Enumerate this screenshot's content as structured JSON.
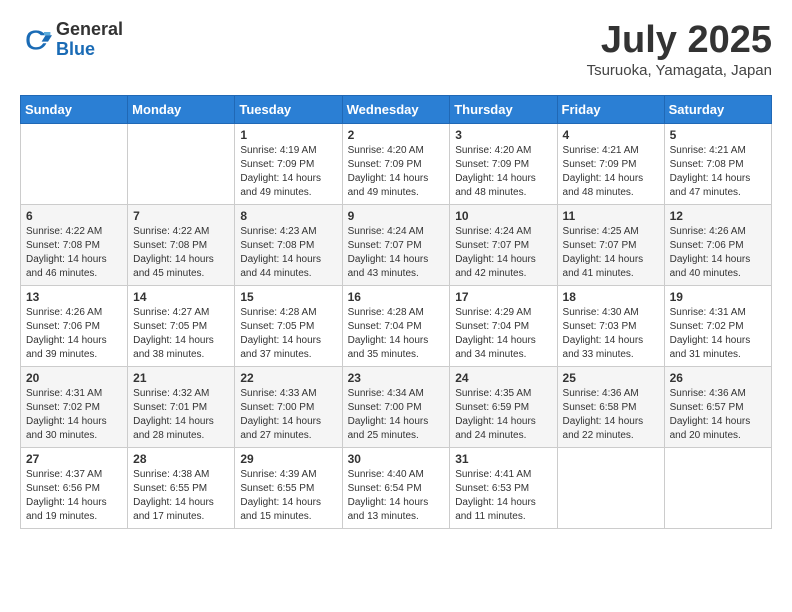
{
  "header": {
    "logo_general": "General",
    "logo_blue": "Blue",
    "month_title": "July 2025",
    "location": "Tsuruoka, Yamagata, Japan"
  },
  "weekdays": [
    "Sunday",
    "Monday",
    "Tuesday",
    "Wednesday",
    "Thursday",
    "Friday",
    "Saturday"
  ],
  "weeks": [
    [
      {
        "day": "",
        "sunrise": "",
        "sunset": "",
        "daylight": ""
      },
      {
        "day": "",
        "sunrise": "",
        "sunset": "",
        "daylight": ""
      },
      {
        "day": "1",
        "sunrise": "Sunrise: 4:19 AM",
        "sunset": "Sunset: 7:09 PM",
        "daylight": "Daylight: 14 hours and 49 minutes."
      },
      {
        "day": "2",
        "sunrise": "Sunrise: 4:20 AM",
        "sunset": "Sunset: 7:09 PM",
        "daylight": "Daylight: 14 hours and 49 minutes."
      },
      {
        "day": "3",
        "sunrise": "Sunrise: 4:20 AM",
        "sunset": "Sunset: 7:09 PM",
        "daylight": "Daylight: 14 hours and 48 minutes."
      },
      {
        "day": "4",
        "sunrise": "Sunrise: 4:21 AM",
        "sunset": "Sunset: 7:09 PM",
        "daylight": "Daylight: 14 hours and 48 minutes."
      },
      {
        "day": "5",
        "sunrise": "Sunrise: 4:21 AM",
        "sunset": "Sunset: 7:08 PM",
        "daylight": "Daylight: 14 hours and 47 minutes."
      }
    ],
    [
      {
        "day": "6",
        "sunrise": "Sunrise: 4:22 AM",
        "sunset": "Sunset: 7:08 PM",
        "daylight": "Daylight: 14 hours and 46 minutes."
      },
      {
        "day": "7",
        "sunrise": "Sunrise: 4:22 AM",
        "sunset": "Sunset: 7:08 PM",
        "daylight": "Daylight: 14 hours and 45 minutes."
      },
      {
        "day": "8",
        "sunrise": "Sunrise: 4:23 AM",
        "sunset": "Sunset: 7:08 PM",
        "daylight": "Daylight: 14 hours and 44 minutes."
      },
      {
        "day": "9",
        "sunrise": "Sunrise: 4:24 AM",
        "sunset": "Sunset: 7:07 PM",
        "daylight": "Daylight: 14 hours and 43 minutes."
      },
      {
        "day": "10",
        "sunrise": "Sunrise: 4:24 AM",
        "sunset": "Sunset: 7:07 PM",
        "daylight": "Daylight: 14 hours and 42 minutes."
      },
      {
        "day": "11",
        "sunrise": "Sunrise: 4:25 AM",
        "sunset": "Sunset: 7:07 PM",
        "daylight": "Daylight: 14 hours and 41 minutes."
      },
      {
        "day": "12",
        "sunrise": "Sunrise: 4:26 AM",
        "sunset": "Sunset: 7:06 PM",
        "daylight": "Daylight: 14 hours and 40 minutes."
      }
    ],
    [
      {
        "day": "13",
        "sunrise": "Sunrise: 4:26 AM",
        "sunset": "Sunset: 7:06 PM",
        "daylight": "Daylight: 14 hours and 39 minutes."
      },
      {
        "day": "14",
        "sunrise": "Sunrise: 4:27 AM",
        "sunset": "Sunset: 7:05 PM",
        "daylight": "Daylight: 14 hours and 38 minutes."
      },
      {
        "day": "15",
        "sunrise": "Sunrise: 4:28 AM",
        "sunset": "Sunset: 7:05 PM",
        "daylight": "Daylight: 14 hours and 37 minutes."
      },
      {
        "day": "16",
        "sunrise": "Sunrise: 4:28 AM",
        "sunset": "Sunset: 7:04 PM",
        "daylight": "Daylight: 14 hours and 35 minutes."
      },
      {
        "day": "17",
        "sunrise": "Sunrise: 4:29 AM",
        "sunset": "Sunset: 7:04 PM",
        "daylight": "Daylight: 14 hours and 34 minutes."
      },
      {
        "day": "18",
        "sunrise": "Sunrise: 4:30 AM",
        "sunset": "Sunset: 7:03 PM",
        "daylight": "Daylight: 14 hours and 33 minutes."
      },
      {
        "day": "19",
        "sunrise": "Sunrise: 4:31 AM",
        "sunset": "Sunset: 7:02 PM",
        "daylight": "Daylight: 14 hours and 31 minutes."
      }
    ],
    [
      {
        "day": "20",
        "sunrise": "Sunrise: 4:31 AM",
        "sunset": "Sunset: 7:02 PM",
        "daylight": "Daylight: 14 hours and 30 minutes."
      },
      {
        "day": "21",
        "sunrise": "Sunrise: 4:32 AM",
        "sunset": "Sunset: 7:01 PM",
        "daylight": "Daylight: 14 hours and 28 minutes."
      },
      {
        "day": "22",
        "sunrise": "Sunrise: 4:33 AM",
        "sunset": "Sunset: 7:00 PM",
        "daylight": "Daylight: 14 hours and 27 minutes."
      },
      {
        "day": "23",
        "sunrise": "Sunrise: 4:34 AM",
        "sunset": "Sunset: 7:00 PM",
        "daylight": "Daylight: 14 hours and 25 minutes."
      },
      {
        "day": "24",
        "sunrise": "Sunrise: 4:35 AM",
        "sunset": "Sunset: 6:59 PM",
        "daylight": "Daylight: 14 hours and 24 minutes."
      },
      {
        "day": "25",
        "sunrise": "Sunrise: 4:36 AM",
        "sunset": "Sunset: 6:58 PM",
        "daylight": "Daylight: 14 hours and 22 minutes."
      },
      {
        "day": "26",
        "sunrise": "Sunrise: 4:36 AM",
        "sunset": "Sunset: 6:57 PM",
        "daylight": "Daylight: 14 hours and 20 minutes."
      }
    ],
    [
      {
        "day": "27",
        "sunrise": "Sunrise: 4:37 AM",
        "sunset": "Sunset: 6:56 PM",
        "daylight": "Daylight: 14 hours and 19 minutes."
      },
      {
        "day": "28",
        "sunrise": "Sunrise: 4:38 AM",
        "sunset": "Sunset: 6:55 PM",
        "daylight": "Daylight: 14 hours and 17 minutes."
      },
      {
        "day": "29",
        "sunrise": "Sunrise: 4:39 AM",
        "sunset": "Sunset: 6:55 PM",
        "daylight": "Daylight: 14 hours and 15 minutes."
      },
      {
        "day": "30",
        "sunrise": "Sunrise: 4:40 AM",
        "sunset": "Sunset: 6:54 PM",
        "daylight": "Daylight: 14 hours and 13 minutes."
      },
      {
        "day": "31",
        "sunrise": "Sunrise: 4:41 AM",
        "sunset": "Sunset: 6:53 PM",
        "daylight": "Daylight: 14 hours and 11 minutes."
      },
      {
        "day": "",
        "sunrise": "",
        "sunset": "",
        "daylight": ""
      },
      {
        "day": "",
        "sunrise": "",
        "sunset": "",
        "daylight": ""
      }
    ]
  ]
}
